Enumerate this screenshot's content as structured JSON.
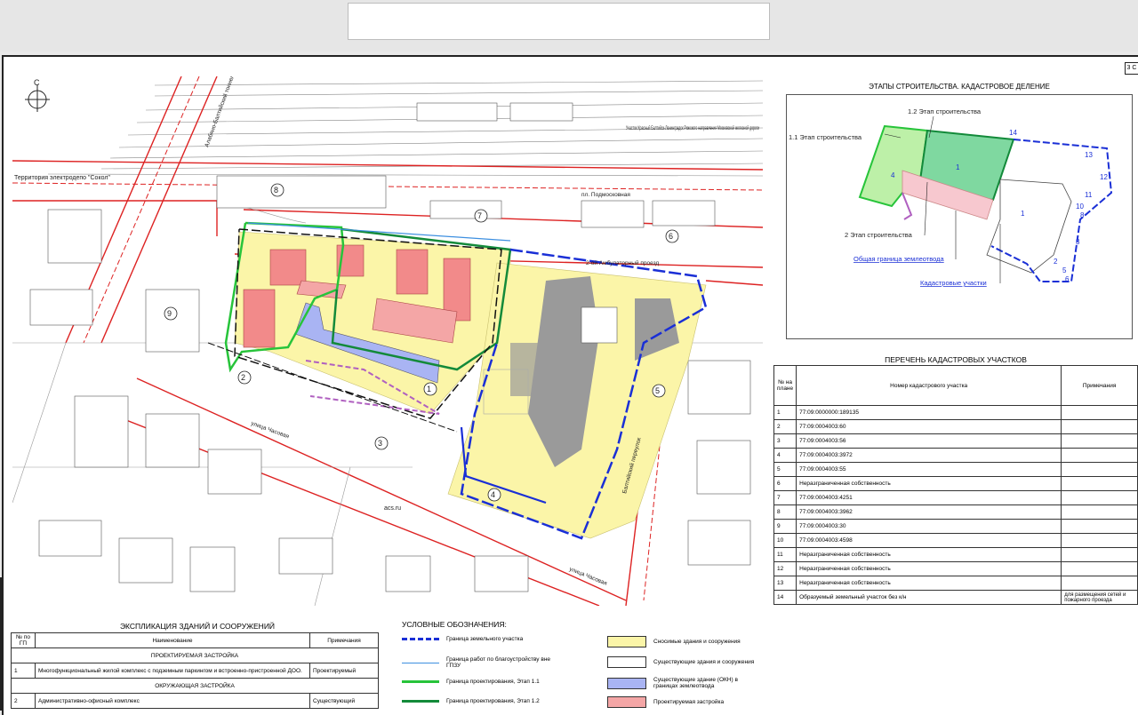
{
  "sheet_number": "3 С",
  "inset": {
    "title": "ЭТАПЫ СТРОИТЕЛЬСТВА. КАДАСТРОВОЕ ДЕЛЕНИЕ",
    "labels": {
      "stage_1_2": "1.2 Этап строительства",
      "stage_1_1": "1.1 Этап строительства",
      "stage_2": "2 Этап строительства",
      "boundary": "Общая граница землеотвода",
      "parcels": "Кадастровые участки"
    }
  },
  "map_labels": {
    "compass": "С",
    "territory": "Территория электродепо \"Сокол\"",
    "railway_note": "Участок Красный Балтийск-Ленинградск Рижского направления Московской железной дороги",
    "street_1": "2-ой Амбулаторный проезд",
    "street_2": "улица Часовая",
    "street_3": "улица Часовая",
    "street_4": "Балтийский переулок",
    "street_5": "пл. Подмосковная",
    "road_vertical": "Алабяно-Балтийский тоннель",
    "acs": "acs.ru"
  },
  "cadastral": {
    "title": "ПЕРЕЧЕНЬ КАДАСТРОВЫХ УЧАСТКОВ",
    "headers": [
      "№ на плане",
      "Номер кадастрового участка",
      "Примечания"
    ],
    "rows": [
      [
        "1",
        "77:09:0000000:189135",
        ""
      ],
      [
        "2",
        "77:09:0004003:60",
        ""
      ],
      [
        "3",
        "77:09:0004003:56",
        ""
      ],
      [
        "4",
        "77:09:0004003:3972",
        ""
      ],
      [
        "5",
        "77:09:0004003:55",
        ""
      ],
      [
        "6",
        "Неразграниченная собственность",
        ""
      ],
      [
        "7",
        "77:09:0004003:4251",
        ""
      ],
      [
        "8",
        "77:09:0004003:3962",
        ""
      ],
      [
        "9",
        "77:09:0004003:30",
        ""
      ],
      [
        "10",
        "77:09:0004003:4598",
        ""
      ],
      [
        "11",
        "Неразграниченная собственность",
        ""
      ],
      [
        "12",
        "Неразграниченная собственность",
        ""
      ],
      [
        "13",
        "Неразграниченная собственность",
        ""
      ],
      [
        "14",
        "Образуемый земельный участок без к/н",
        "для размещения сетей и пожарного проезда"
      ]
    ]
  },
  "explication": {
    "title": "ЭКСПЛИКАЦИЯ ЗДАНИЙ И СООРУЖЕНИЙ",
    "headers": [
      "№ по ГП",
      "Наименование",
      "Примечания"
    ],
    "section_1": "ПРОЕКТИРУЕМАЯ ЗАСТРОЙКА",
    "row_1": [
      "1",
      "Многофункциональный жилой комплекс с подземным паркингом и встроенно-пристроенной ДОО.",
      "Проектируемый"
    ],
    "section_2": "ОКРУЖАЮЩАЯ ЗАСТРОЙКА",
    "row_2": [
      "2",
      "Административно-офисный комплекс",
      "Существующий"
    ]
  },
  "legend": {
    "title": "УСЛОВНЫЕ ОБОЗНАЧЕНИЯ:",
    "items": [
      {
        "label": "Граница земельного участка",
        "color": "#1a2fd6"
      },
      {
        "label": "Граница работ по благоустройству вне ГПЗУ",
        "color": "#3d8fe0"
      },
      {
        "label": "Граница проектирования, Этап 1.1",
        "color": "#27c43a"
      },
      {
        "label": "Граница проектирования, Этап 1.2",
        "color": "#138a3a"
      },
      {
        "label": "Сносимые здания и сооружения",
        "color": "#fbf5a8"
      },
      {
        "label": "Существующие здания и сооружения",
        "color": "#ffffff"
      },
      {
        "label": "Существующие здание (ОКН) в границах землеотвода",
        "color": "#a9b4f3"
      },
      {
        "label": "Проектируемая застройка",
        "color": "#f4a6a6"
      }
    ]
  }
}
